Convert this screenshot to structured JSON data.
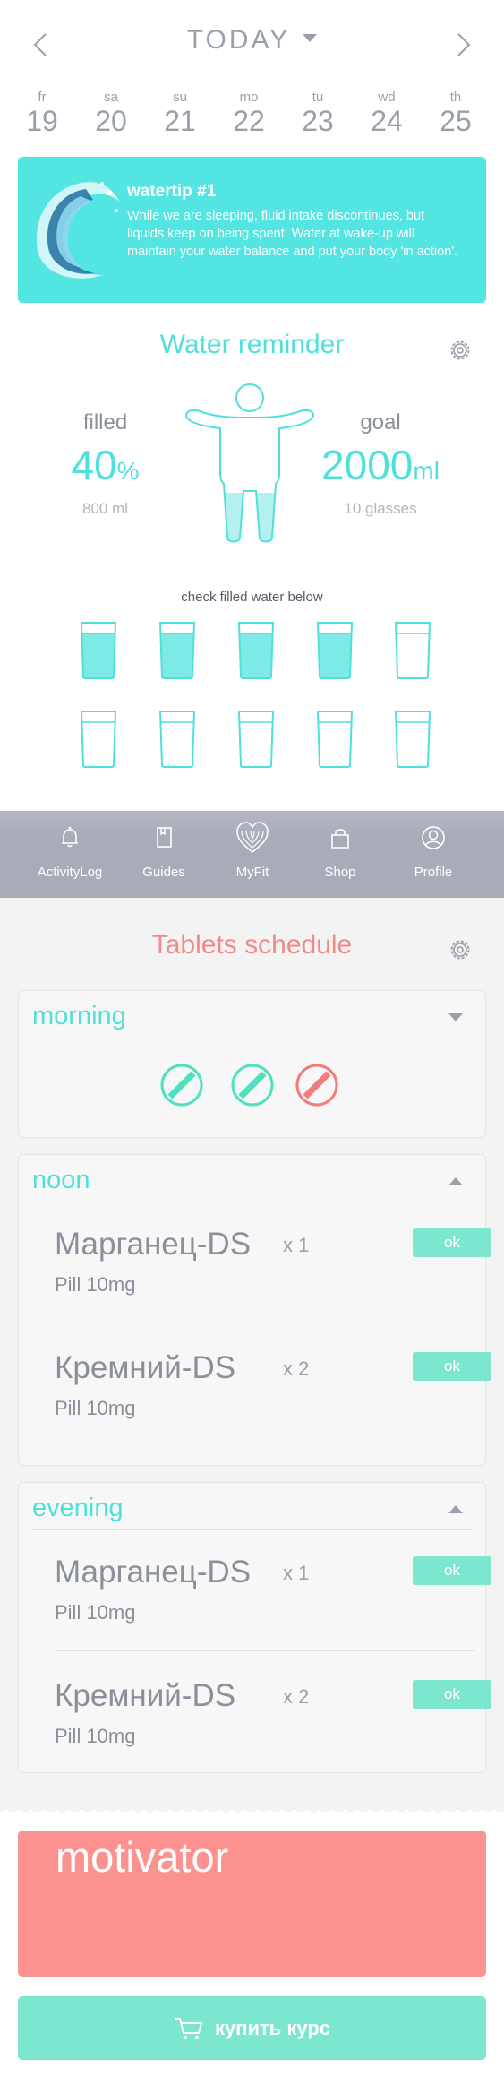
{
  "header": {
    "title": "TODAY",
    "prev_icon": "chevron-left-icon",
    "next_icon": "chevron-right-icon",
    "dropdown_icon": "caret-down-icon"
  },
  "days": [
    {
      "name": "fr",
      "date": "19"
    },
    {
      "name": "sa",
      "date": "20"
    },
    {
      "name": "su",
      "date": "21"
    },
    {
      "name": "mo",
      "date": "22"
    },
    {
      "name": "tu",
      "date": "23"
    },
    {
      "name": "wd",
      "date": "24"
    },
    {
      "name": "th",
      "date": "25"
    }
  ],
  "watertip": {
    "title": "watertip #1",
    "text": "While we are sleeping, fluid intake discontinues, but liquids keep on being spent. Water at wake-up will maintain your water balance and put your body 'in action'."
  },
  "water": {
    "title": "Water reminder",
    "filled_label": "filled",
    "filled_value": "40",
    "filled_unit": "%",
    "filled_ml": "800 ml",
    "goal_label": "goal",
    "goal_value": "2000",
    "goal_unit": "ml",
    "goal_glasses": "10 glasses",
    "check_label": "check filled water below",
    "fill_fraction": 0.4,
    "glasses_filled": [
      true,
      true,
      true,
      true,
      false,
      false,
      false,
      false,
      false,
      false
    ]
  },
  "tabs": [
    {
      "label": "ActivityLog",
      "icon": "bell-icon"
    },
    {
      "label": "Guides",
      "icon": "book-icon"
    },
    {
      "label": "MyFit",
      "icon": "fingerprint-heart-icon"
    },
    {
      "label": "Shop",
      "icon": "shopping-bag-icon"
    },
    {
      "label": "Profile",
      "icon": "user-icon"
    }
  ],
  "tablets": {
    "title": "Tablets schedule",
    "morning": {
      "label": "morning",
      "pills": [
        {
          "status": "taken",
          "color": "#4fe0c0"
        },
        {
          "status": "taken",
          "color": "#4fe0c0"
        },
        {
          "status": "missed",
          "color": "#f27b7b"
        }
      ]
    },
    "noon": {
      "label": "noon",
      "items": [
        {
          "name": "Марганец-DS",
          "qty": "x 1",
          "dose": "Pill 10mg",
          "ok": "ok"
        },
        {
          "name": "Кремний-DS",
          "qty": "x 2",
          "dose": "Pill 10mg",
          "ok": "ok"
        }
      ]
    },
    "evening": {
      "label": "evening",
      "items": [
        {
          "name": "Марганец-DS",
          "qty": "x 1",
          "dose": "Pill 10mg",
          "ok": "ok"
        },
        {
          "name": "Кремний-DS",
          "qty": "x 2",
          "dose": "Pill 10mg",
          "ok": "ok"
        }
      ]
    }
  },
  "motivator": {
    "title": "motivator"
  },
  "buy": {
    "label": "купить курс",
    "icon": "cart-icon"
  },
  "colors": {
    "accent": "#4fe0dc",
    "tip_bg": "#52e5e2",
    "tablets_title": "#f08a8a",
    "motivator_bg": "#fb9290",
    "button_bg": "#7ce6cf",
    "tabbar_bg": "#a7acb8"
  }
}
